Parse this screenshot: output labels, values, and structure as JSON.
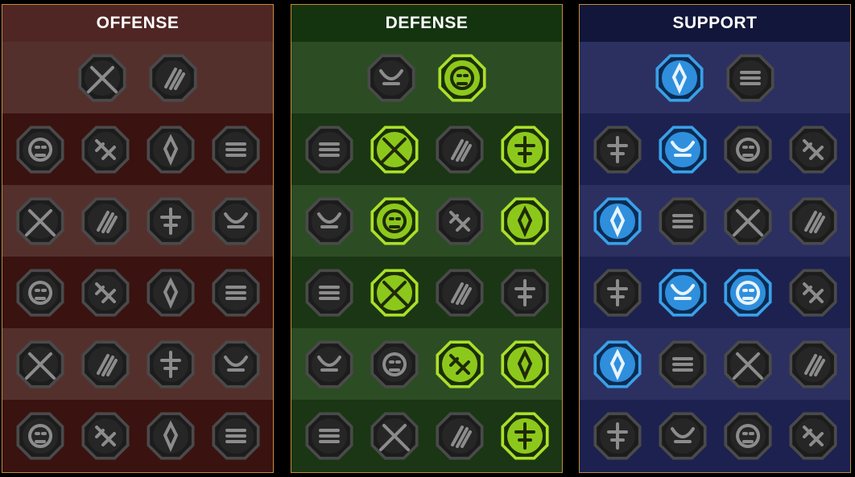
{
  "colors": {
    "offense": {
      "header": "#4f2624",
      "row_a": "#3a1210",
      "row_b": "#54302d"
    },
    "defense": {
      "header": "#14330f",
      "row_a": "#1a3614",
      "row_b": "#2c4c24"
    },
    "support": {
      "header": "#12163a",
      "row_a": "#1c2150",
      "row_b": "#2b3060"
    },
    "border": "#c78a3c",
    "locked_fill": "#1c1c1c",
    "locked_glyph": "#8c8c8c",
    "green_active": "#a8e02a",
    "blue_active": "#3aa0e8"
  },
  "panels": [
    {
      "key": "offense",
      "title": "OFFENSE",
      "rows": [
        [
          {
            "icon": "crossed-swords-icon",
            "state": "locked"
          },
          {
            "icon": "claw-slash-icon",
            "state": "locked"
          }
        ],
        [
          {
            "icon": "horned-demon-icon",
            "state": "locked"
          },
          {
            "icon": "flying-blades-icon",
            "state": "locked"
          },
          {
            "icon": "shield-slash-icon",
            "state": "locked"
          },
          {
            "icon": "heart-horns-icon",
            "state": "locked"
          }
        ],
        [
          {
            "icon": "punch-arm-icon",
            "state": "locked"
          },
          {
            "icon": "fanged-mouth-icon",
            "state": "locked"
          },
          {
            "icon": "skull-slash-icon",
            "state": "locked"
          },
          {
            "icon": "fist-slash-icon",
            "state": "locked"
          }
        ],
        [
          {
            "icon": "bleeding-sword-icon",
            "state": "locked"
          },
          {
            "icon": "fist-impact-icon",
            "state": "locked"
          },
          {
            "icon": "double-axe-icon",
            "state": "locked"
          },
          {
            "icon": "lightning-chain-icon",
            "state": "locked"
          }
        ],
        [
          {
            "icon": "explosion-icon",
            "state": "locked"
          },
          {
            "icon": "skull-blast-icon",
            "state": "locked"
          },
          {
            "icon": "dagger-circle-icon",
            "state": "locked"
          },
          {
            "icon": "warrior-rage-icon",
            "state": "locked"
          }
        ],
        [
          {
            "icon": "sparkle-sword-icon",
            "state": "locked"
          },
          {
            "icon": "knight-helmet-icon",
            "state": "locked"
          },
          {
            "icon": "horned-brute-icon",
            "state": "locked"
          },
          {
            "icon": "spartan-helmet-icon",
            "state": "locked"
          }
        ]
      ]
    },
    {
      "key": "defense",
      "title": "DEFENSE",
      "rows": [
        [
          {
            "icon": "armor-plates-icon",
            "state": "locked"
          },
          {
            "icon": "raised-fist-icon",
            "state": "active"
          }
        ],
        [
          {
            "icon": "chevron-shield-icon",
            "state": "locked"
          },
          {
            "icon": "heart-organ-icon",
            "state": "active"
          },
          {
            "icon": "muscle-body-icon",
            "state": "locked"
          },
          {
            "icon": "deflect-slash-icon",
            "state": "active"
          }
        ],
        [
          {
            "icon": "dodge-figure-icon",
            "state": "locked"
          },
          {
            "icon": "knight-shield-icon",
            "state": "active"
          },
          {
            "icon": "skull-heart-icon",
            "state": "locked"
          },
          {
            "icon": "aura-figure-icon",
            "state": "active"
          }
        ],
        [
          {
            "icon": "crowd-icon",
            "state": "locked"
          },
          {
            "icon": "hourglass-icon",
            "state": "active"
          },
          {
            "icon": "palm-icon",
            "state": "locked"
          },
          {
            "icon": "bull-head-icon",
            "state": "locked"
          }
        ],
        [
          {
            "icon": "speed-runner-icon",
            "state": "locked"
          },
          {
            "icon": "drops-icon",
            "state": "locked"
          },
          {
            "icon": "radiant-skull-icon",
            "state": "active"
          },
          {
            "icon": "counter-strike-icon",
            "state": "active"
          }
        ],
        [
          {
            "icon": "ogre-icon",
            "state": "locked"
          },
          {
            "icon": "winged-shield-icon",
            "state": "locked"
          },
          {
            "icon": "bearded-warrior-icon",
            "state": "locked"
          },
          {
            "icon": "flexing-figure-icon",
            "state": "active"
          }
        ]
      ]
    },
    {
      "key": "support",
      "title": "SUPPORT",
      "rows": [
        [
          {
            "icon": "heart-plus-icon",
            "state": "active"
          },
          {
            "icon": "hand-target-icon",
            "state": "locked"
          }
        ],
        [
          {
            "icon": "praying-hands-icon",
            "state": "locked"
          },
          {
            "icon": "aura-shield-icon",
            "state": "active"
          },
          {
            "icon": "flaming-skull-icon",
            "state": "locked"
          },
          {
            "icon": "push-hand-icon",
            "state": "locked"
          }
        ],
        [
          {
            "icon": "buffed-figure-icon",
            "state": "active"
          },
          {
            "icon": "lightning-shield-icon",
            "state": "locked"
          },
          {
            "icon": "cracked-ground-icon",
            "state": "locked"
          },
          {
            "icon": "shadow-figures-icon",
            "state": "locked"
          }
        ],
        [
          {
            "icon": "chained-heart-icon",
            "state": "locked"
          },
          {
            "icon": "comet-icon",
            "state": "active"
          },
          {
            "icon": "open-book-icon",
            "state": "active"
          },
          {
            "icon": "angry-eyes-icon",
            "state": "locked"
          }
        ],
        [
          {
            "icon": "compass-star-icon",
            "state": "active"
          },
          {
            "icon": "boot-icon",
            "state": "locked"
          },
          {
            "icon": "eye-icon",
            "state": "locked"
          },
          {
            "icon": "crossbones-icon",
            "state": "locked"
          }
        ],
        [
          {
            "icon": "potion-icon",
            "state": "locked"
          },
          {
            "icon": "skull-wings-icon",
            "state": "locked"
          },
          {
            "icon": "stomp-fist-icon",
            "state": "locked"
          },
          {
            "icon": "eagle-head-icon",
            "state": "locked"
          }
        ]
      ]
    }
  ]
}
